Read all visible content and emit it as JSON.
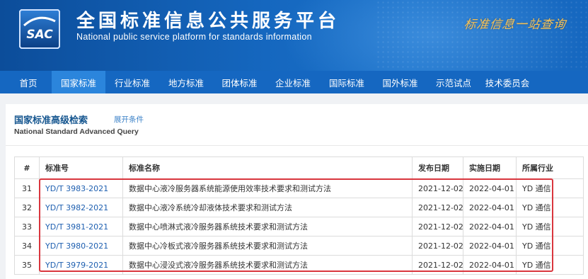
{
  "header": {
    "logo_text": "SAC",
    "title_cn": "全国标准信息公共服务平台",
    "title_en": "National public service platform  for standards information",
    "slogan": "标准信息一站查询"
  },
  "nav": {
    "items": [
      {
        "label": "首页",
        "active": false
      },
      {
        "label": "国家标准",
        "active": true
      },
      {
        "label": "行业标准",
        "active": false
      },
      {
        "label": "地方标准",
        "active": false
      },
      {
        "label": "团体标准",
        "active": false
      },
      {
        "label": "企业标准",
        "active": false
      },
      {
        "label": "国际标准",
        "active": false
      },
      {
        "label": "国外标准",
        "active": false
      },
      {
        "label": "示范试点",
        "active": false
      },
      {
        "label": "技术委员会",
        "active": false
      }
    ]
  },
  "query": {
    "title": "国家标准高级检索",
    "expand_link": "展开条件",
    "title_en": "National Standard Advanced Query"
  },
  "table": {
    "columns": [
      "#",
      "标准号",
      "标准名称",
      "发布日期",
      "实施日期",
      "所属行业"
    ],
    "rows": [
      {
        "index": "31",
        "code": "YD/T 3983-2021",
        "name": "数据中心液冷服务器系统能源使用效率技术要求和测试方法",
        "publish": "2021-12-02",
        "implement": "2022-04-01",
        "industry": "YD 通信"
      },
      {
        "index": "32",
        "code": "YD/T 3982-2021",
        "name": "数据中心液冷系统冷却液体技术要求和测试方法",
        "publish": "2021-12-02",
        "implement": "2022-04-01",
        "industry": "YD 通信"
      },
      {
        "index": "33",
        "code": "YD/T 3981-2021",
        "name": "数据中心喷淋式液冷服务器系统技术要求和测试方法",
        "publish": "2021-12-02",
        "implement": "2022-04-01",
        "industry": "YD 通信"
      },
      {
        "index": "34",
        "code": "YD/T 3980-2021",
        "name": "数据中心冷板式液冷服务器系统技术要求和测试方法",
        "publish": "2021-12-02",
        "implement": "2022-04-01",
        "industry": "YD 通信"
      },
      {
        "index": "35",
        "code": "YD/T 3979-2021",
        "name": "数据中心浸没式液冷服务器系统技术要求和测试方法",
        "publish": "2021-12-02",
        "implement": "2022-04-01",
        "industry": "YD 通信"
      }
    ]
  },
  "colors": {
    "banner": "#1567bf",
    "nav": "#1567c1",
    "nav_active": "#2b85dc",
    "link": "#1e5fb0",
    "highlight": "#d9363e"
  }
}
